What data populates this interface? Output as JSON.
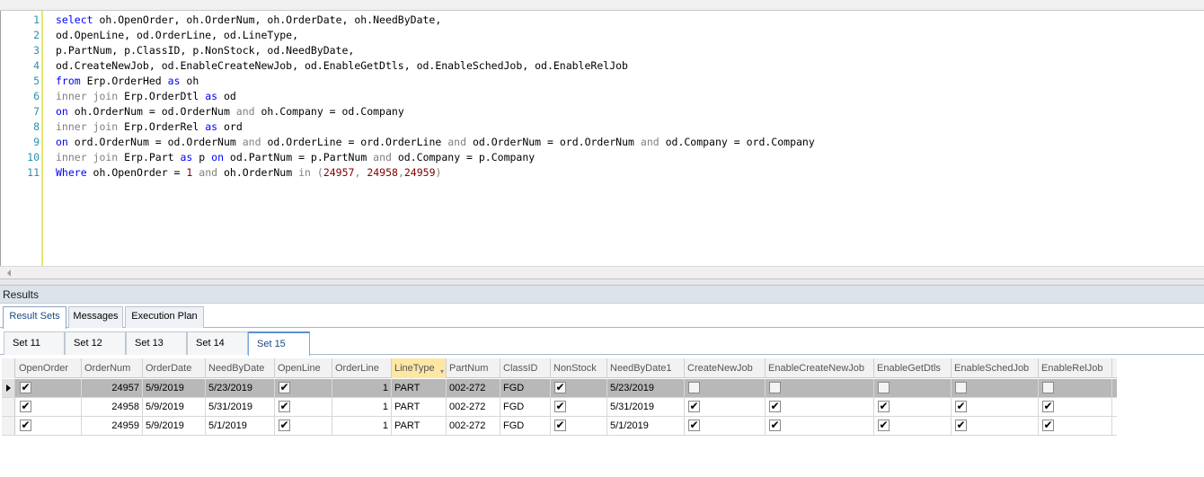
{
  "editor": {
    "lines": [
      [
        [
          "kw",
          "select"
        ],
        [
          "t",
          " oh.OpenOrder, oh.OrderNum, oh.OrderDate, oh.NeedByDate,"
        ]
      ],
      [
        [
          "t",
          "od.OpenLine, od.OrderLine, od.LineType,"
        ]
      ],
      [
        [
          "t",
          "p.PartNum, p.ClassID, p.NonStock, od.NeedByDate,"
        ]
      ],
      [
        [
          "t",
          "od.CreateNewJob, od.EnableCreateNewJob, od.EnableGetDtls, od.EnableSchedJob, od.EnableRelJob"
        ]
      ],
      [
        [
          "kw",
          "from"
        ],
        [
          "t",
          " Erp.OrderHed "
        ],
        [
          "kw",
          "as"
        ],
        [
          "t",
          " oh"
        ]
      ],
      [
        [
          "op",
          "inner join"
        ],
        [
          "t",
          " Erp.OrderDtl "
        ],
        [
          "kw",
          "as"
        ],
        [
          "t",
          " od"
        ]
      ],
      [
        [
          "kw",
          "on"
        ],
        [
          "t",
          " oh.OrderNum = od.OrderNum "
        ],
        [
          "op",
          "and"
        ],
        [
          "t",
          " oh.Company = od.Company"
        ]
      ],
      [
        [
          "op",
          "inner join"
        ],
        [
          "t",
          " Erp.OrderRel "
        ],
        [
          "kw",
          "as"
        ],
        [
          "t",
          " ord"
        ]
      ],
      [
        [
          "kw",
          "on"
        ],
        [
          "t",
          " ord.OrderNum = od.OrderNum "
        ],
        [
          "op",
          "and"
        ],
        [
          "t",
          " od.OrderLine = ord.OrderLine "
        ],
        [
          "op",
          "and"
        ],
        [
          "t",
          " od.OrderNum = ord.OrderNum "
        ],
        [
          "op",
          "and"
        ],
        [
          "t",
          " od.Company = ord.Company"
        ]
      ],
      [
        [
          "op",
          "inner join"
        ],
        [
          "t",
          " Erp.Part "
        ],
        [
          "kw",
          "as"
        ],
        [
          "t",
          " p "
        ],
        [
          "kw",
          "on"
        ],
        [
          "t",
          " od.PartNum = p.PartNum "
        ],
        [
          "op",
          "and"
        ],
        [
          "t",
          " od.Company = p.Company"
        ]
      ],
      [
        [
          "kw",
          "Where"
        ],
        [
          "t",
          " oh.OpenOrder = "
        ],
        [
          "num",
          "1"
        ],
        [
          "t",
          " "
        ],
        [
          "op",
          "and"
        ],
        [
          "t",
          " oh.OrderNum "
        ],
        [
          "op",
          "in"
        ],
        [
          "t",
          " "
        ],
        [
          "op",
          "("
        ],
        [
          "num",
          "24957"
        ],
        [
          "op",
          ","
        ],
        [
          "t",
          " "
        ],
        [
          "num",
          "24958"
        ],
        [
          "op",
          ","
        ],
        [
          "num",
          "24959"
        ],
        [
          "op",
          ")"
        ]
      ]
    ]
  },
  "results": {
    "header": "Results",
    "tabs": [
      "Result Sets",
      "Messages",
      "Execution Plan"
    ],
    "active_tab": 0,
    "sets": [
      "Set 11",
      "Set 12",
      "Set 13",
      "Set 14",
      "Set 15"
    ],
    "active_set": 4
  },
  "grid": {
    "columns": [
      "OpenOrder",
      "OrderNum",
      "OrderDate",
      "NeedByDate",
      "OpenLine",
      "OrderLine",
      "LineType",
      "PartNum",
      "ClassID",
      "NonStock",
      "NeedByDate1",
      "CreateNewJob",
      "EnableCreateNewJob",
      "EnableGetDtls",
      "EnableSchedJob",
      "EnableRelJob"
    ],
    "sorted_column": "LineType",
    "rows": [
      {
        "OpenOrder": true,
        "OrderNum": "24957",
        "OrderDate": "5/9/2019",
        "NeedByDate": "5/23/2019",
        "OpenLine": true,
        "OrderLine": "1",
        "LineType": "PART",
        "PartNum": "002-272",
        "ClassID": "FGD",
        "NonStock": true,
        "NeedByDate1": "5/23/2019",
        "CreateNewJob": false,
        "EnableCreateNewJob": false,
        "EnableGetDtls": false,
        "EnableSchedJob": false,
        "EnableRelJob": false
      },
      {
        "OpenOrder": true,
        "OrderNum": "24958",
        "OrderDate": "5/9/2019",
        "NeedByDate": "5/31/2019",
        "OpenLine": true,
        "OrderLine": "1",
        "LineType": "PART",
        "PartNum": "002-272",
        "ClassID": "FGD",
        "NonStock": true,
        "NeedByDate1": "5/31/2019",
        "CreateNewJob": true,
        "EnableCreateNewJob": true,
        "EnableGetDtls": true,
        "EnableSchedJob": true,
        "EnableRelJob": true
      },
      {
        "OpenOrder": true,
        "OrderNum": "24959",
        "OrderDate": "5/9/2019",
        "NeedByDate": "5/1/2019",
        "OpenLine": true,
        "OrderLine": "1",
        "LineType": "PART",
        "PartNum": "002-272",
        "ClassID": "FGD",
        "NonStock": true,
        "NeedByDate1": "5/1/2019",
        "CreateNewJob": true,
        "EnableCreateNewJob": true,
        "EnableGetDtls": true,
        "EnableSchedJob": true,
        "EnableRelJob": true
      }
    ],
    "selected_row": 0
  },
  "colors": {
    "keyword": "#0000ff",
    "operator": "#808080",
    "number": "#800000",
    "line_number": "#2b91af",
    "selected_row": "#b8b8b8",
    "sorted_header": "#fde7a5"
  }
}
